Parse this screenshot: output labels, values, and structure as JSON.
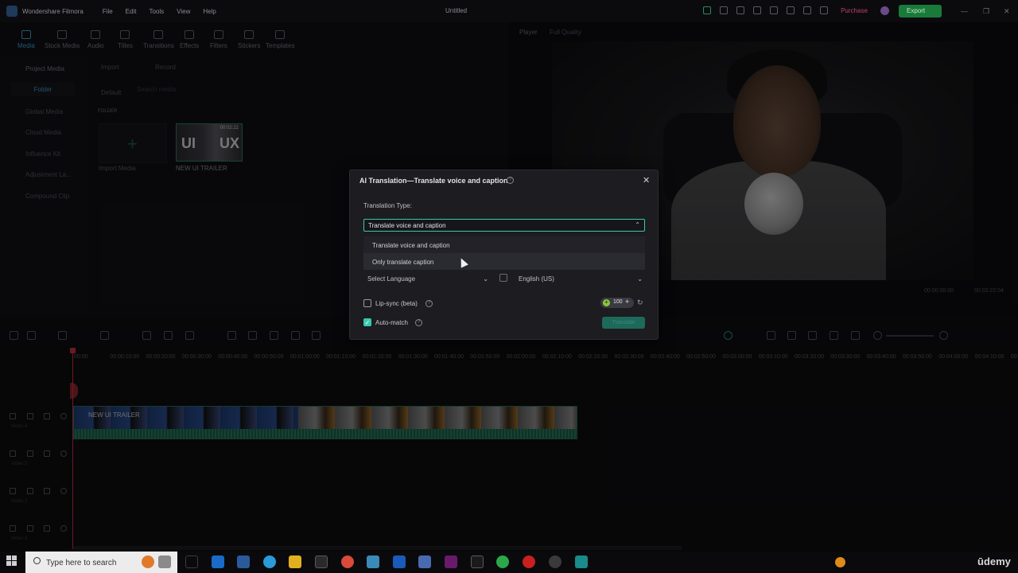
{
  "titlebar": {
    "app_name": "Wondershare Filmora",
    "menus": [
      "File",
      "Edit",
      "Tools",
      "View",
      "Help"
    ],
    "doc_title": "Untitled",
    "purchase_label": "Purchase",
    "export_label": "Export"
  },
  "toolbar": {
    "tabs": [
      {
        "label": "Media",
        "icon": "media-icon"
      },
      {
        "label": "Stock Media",
        "icon": "stock-media-icon"
      },
      {
        "label": "Audio",
        "icon": "audio-icon"
      },
      {
        "label": "Titles",
        "icon": "titles-icon"
      },
      {
        "label": "Transitions",
        "icon": "transitions-icon"
      },
      {
        "label": "Effects",
        "icon": "effects-icon"
      },
      {
        "label": "Filters",
        "icon": "filters-icon"
      },
      {
        "label": "Stickers",
        "icon": "stickers-icon"
      },
      {
        "label": "Templates",
        "icon": "templates-icon"
      }
    ],
    "active_tab": "Media"
  },
  "sidebar": {
    "items": [
      {
        "label": "Project Media"
      },
      {
        "label": "Folder"
      },
      {
        "label": "Global Media"
      },
      {
        "label": "Cloud Media"
      },
      {
        "label": "Influence Kit"
      },
      {
        "label": "Adjustment La..."
      },
      {
        "label": "Compound Clip"
      }
    ]
  },
  "media": {
    "import_label": "Import",
    "record_label": "Record",
    "sort_label": "Default",
    "search_placeholder": "Search media",
    "folder_header": "FOLDER",
    "import_tile_label": "Import Media",
    "clip_label": "NEW UI TRAILER",
    "clip_duration": "00:02:22"
  },
  "player": {
    "label": "Player",
    "quality": "Full Quality",
    "timecode_current": "00:00:00:00",
    "timecode_total": "00:02:22:04"
  },
  "timeline": {
    "ruler_labels": [
      "00:00",
      "00:00:10:00",
      "00:00:20:00",
      "00:00:30:00",
      "00:00:40:00",
      "00:00:50:00",
      "00:01:00:00",
      "00:01:10:00",
      "00:01:20:00",
      "00:01:30:00",
      "00:01:40:00",
      "00:01:50:00",
      "00:02:00:00",
      "00:02:10:00",
      "00:02:20:00",
      "00:02:30:00",
      "00:02:40:00",
      "00:02:50:00",
      "00:03:00:00",
      "00:03:10:00",
      "00:03:20:00",
      "00:03:30:00",
      "00:03:40:00",
      "00:03:50:00",
      "00:04:00:00",
      "00:04:10:00",
      "00:04:20:00"
    ],
    "tracks": [
      {
        "name": "Video 4"
      },
      {
        "name": "Video 3"
      },
      {
        "name": "Video 2"
      },
      {
        "name": "Video 1"
      }
    ],
    "clip_name": "NEW UI TRAILER"
  },
  "dialog": {
    "title": "AI Translation—Translate voice and caption",
    "translation_type_label": "Translation Type:",
    "selected_type": "Translate voice and caption",
    "options": [
      "Translate voice and caption",
      "Only translate caption"
    ],
    "hovered_option": "Only translate caption",
    "source_language_placeholder": "Select Language",
    "target_language": "English (US)",
    "lip_sync_label": "Lip-sync (beta)",
    "lip_sync_checked": false,
    "auto_match_label": "Auto-match",
    "auto_match_checked": true,
    "credits": "100",
    "translate_button": "Translate",
    "accent_color": "#3ac8b0"
  },
  "taskbar": {
    "search_placeholder": "Type here to search",
    "brand": "ūdemy"
  }
}
